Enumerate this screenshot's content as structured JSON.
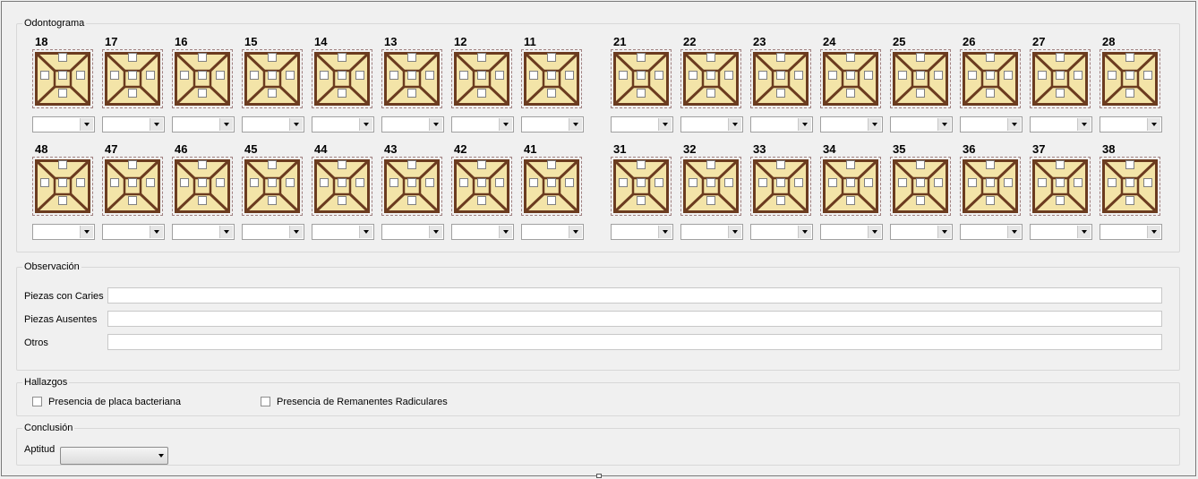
{
  "odontograma": {
    "title": "Odontograma",
    "rows": [
      [
        "18",
        "17",
        "16",
        "15",
        "14",
        "13",
        "12",
        "11",
        "21",
        "22",
        "23",
        "24",
        "25",
        "26",
        "27",
        "28"
      ],
      [
        "48",
        "47",
        "46",
        "45",
        "44",
        "43",
        "42",
        "41",
        "31",
        "32",
        "33",
        "34",
        "35",
        "36",
        "37",
        "38"
      ]
    ],
    "tooth_colors": {
      "fill": "#f3e4a8",
      "border": "#6b3b1f",
      "line": "#6b3b1f"
    }
  },
  "observacion": {
    "title": "Observación",
    "fields": [
      {
        "label": "Piezas con Caries",
        "value": ""
      },
      {
        "label": "Piezas Ausentes",
        "value": ""
      },
      {
        "label": "Otros",
        "value": ""
      }
    ]
  },
  "hallazgos": {
    "title": "Hallazgos",
    "items": [
      {
        "label": "Presencia de placa bacteriana",
        "checked": false
      },
      {
        "label": "Presencia de Remanentes Radiculares",
        "checked": false
      }
    ]
  },
  "conclusion": {
    "title": "Conclusión",
    "aptitud_label": "Aptitud",
    "aptitud_value": ""
  }
}
